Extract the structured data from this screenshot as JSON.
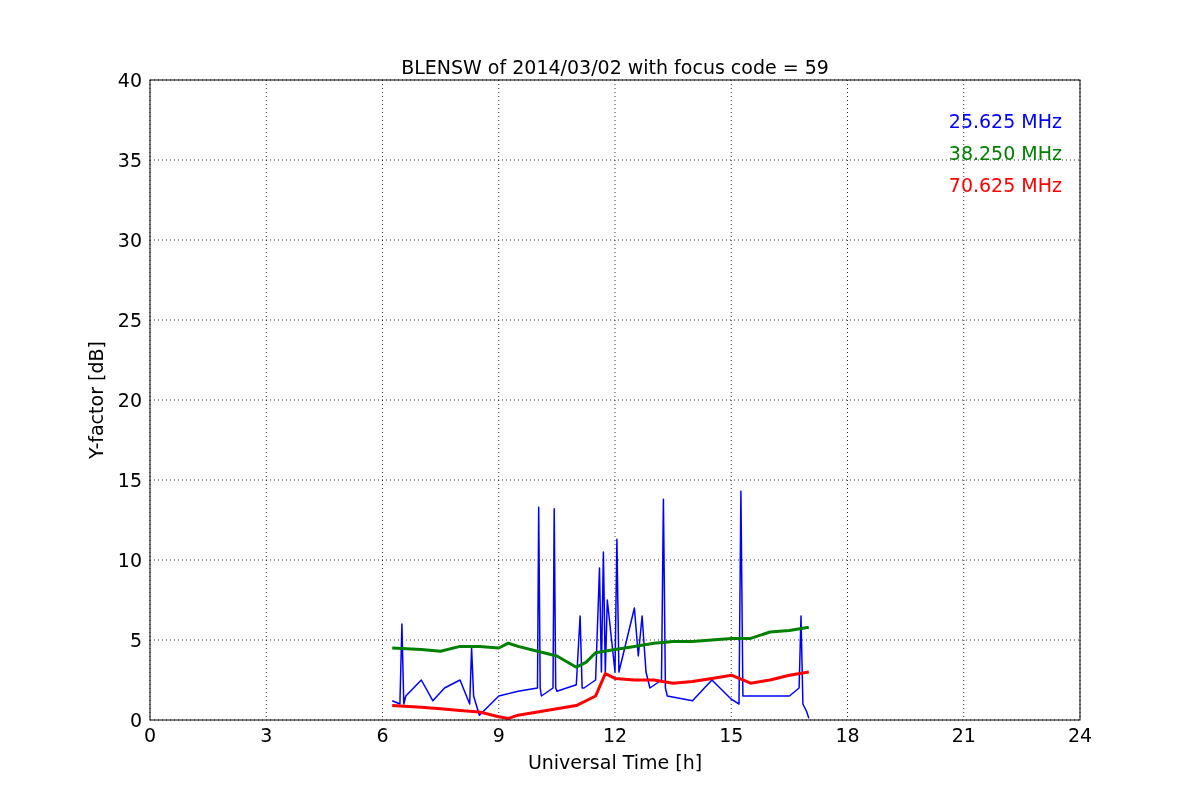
{
  "chart_data": {
    "type": "line",
    "title": "BLENSW of 2014/03/02 with focus code = 59",
    "xlabel": "Universal Time [h]",
    "ylabel": "Y-factor [dB]",
    "xlim": [
      0,
      24
    ],
    "ylim": [
      0,
      40
    ],
    "grid": true,
    "xticks": [
      0,
      3,
      6,
      9,
      12,
      15,
      18,
      21,
      24
    ],
    "yticks": [
      0,
      5,
      10,
      15,
      20,
      25,
      30,
      35,
      40
    ],
    "series": [
      {
        "name": "25.625 MHz",
        "color": "#0000ff",
        "x": [
          6.25,
          6.45,
          6.5,
          6.55,
          6.6,
          7,
          7.3,
          7.6,
          8,
          8.25,
          8.3,
          8.35,
          8.5,
          9,
          9.5,
          10,
          10.03,
          10.07,
          10.1,
          10.4,
          10.43,
          10.47,
          10.5,
          11,
          11.1,
          11.15,
          11.2,
          11.5,
          11.6,
          11.65,
          11.7,
          11.75,
          11.8,
          12,
          12.05,
          12.1,
          12.2,
          12.5,
          12.6,
          12.7,
          12.8,
          12.9,
          13.2,
          13.25,
          13.3,
          13.35,
          14,
          14.5,
          15,
          15.2,
          15.25,
          15.3,
          15.35,
          16,
          16.5,
          16.75,
          16.8,
          16.85,
          16.95,
          17
        ],
        "values": [
          1.2,
          1.0,
          6.0,
          1.0,
          1.5,
          2.5,
          1.2,
          2.0,
          2.5,
          1.0,
          4.5,
          1.5,
          0.3,
          1.5,
          1.8,
          2.0,
          13.3,
          2.0,
          1.5,
          2.0,
          13.2,
          2.0,
          1.8,
          2.2,
          6.5,
          2.0,
          2.0,
          2.5,
          9.5,
          3.0,
          10.5,
          3.0,
          7.5,
          3.0,
          11.3,
          3.0,
          4.0,
          7.0,
          4.0,
          6.5,
          3.0,
          2.0,
          2.5,
          13.8,
          2.0,
          1.5,
          1.2,
          2.5,
          1.3,
          1.0,
          14.3,
          1.5,
          1.5,
          1.5,
          1.5,
          2.0,
          6.5,
          1.0,
          0.5,
          0.1
        ]
      },
      {
        "name": "38.250 MHz",
        "color": "#008000",
        "x": [
          6.25,
          7,
          7.5,
          8,
          8.5,
          9,
          9.25,
          9.5,
          10,
          10.5,
          11,
          11.25,
          11.5,
          12,
          12.5,
          13,
          13.5,
          14,
          14.5,
          15,
          15.5,
          16,
          16.5,
          17
        ],
        "values": [
          4.5,
          4.4,
          4.3,
          4.6,
          4.6,
          4.5,
          4.8,
          4.6,
          4.3,
          4.0,
          3.3,
          3.6,
          4.2,
          4.4,
          4.6,
          4.8,
          4.9,
          4.9,
          5.0,
          5.1,
          5.1,
          5.5,
          5.6,
          5.8
        ]
      },
      {
        "name": "70.625 MHz",
        "color": "#ff0000",
        "x": [
          6.25,
          7,
          7.5,
          8,
          8.5,
          9,
          9.25,
          9.5,
          10,
          10.5,
          11,
          11.5,
          11.75,
          12,
          12.5,
          13,
          13.5,
          14,
          14.5,
          15,
          15.5,
          16,
          16.5,
          17
        ],
        "values": [
          0.9,
          0.8,
          0.7,
          0.6,
          0.5,
          0.2,
          0.1,
          0.3,
          0.5,
          0.7,
          0.9,
          1.5,
          2.9,
          2.6,
          2.5,
          2.5,
          2.3,
          2.4,
          2.6,
          2.8,
          2.3,
          2.5,
          2.8,
          3.0
        ]
      }
    ]
  }
}
